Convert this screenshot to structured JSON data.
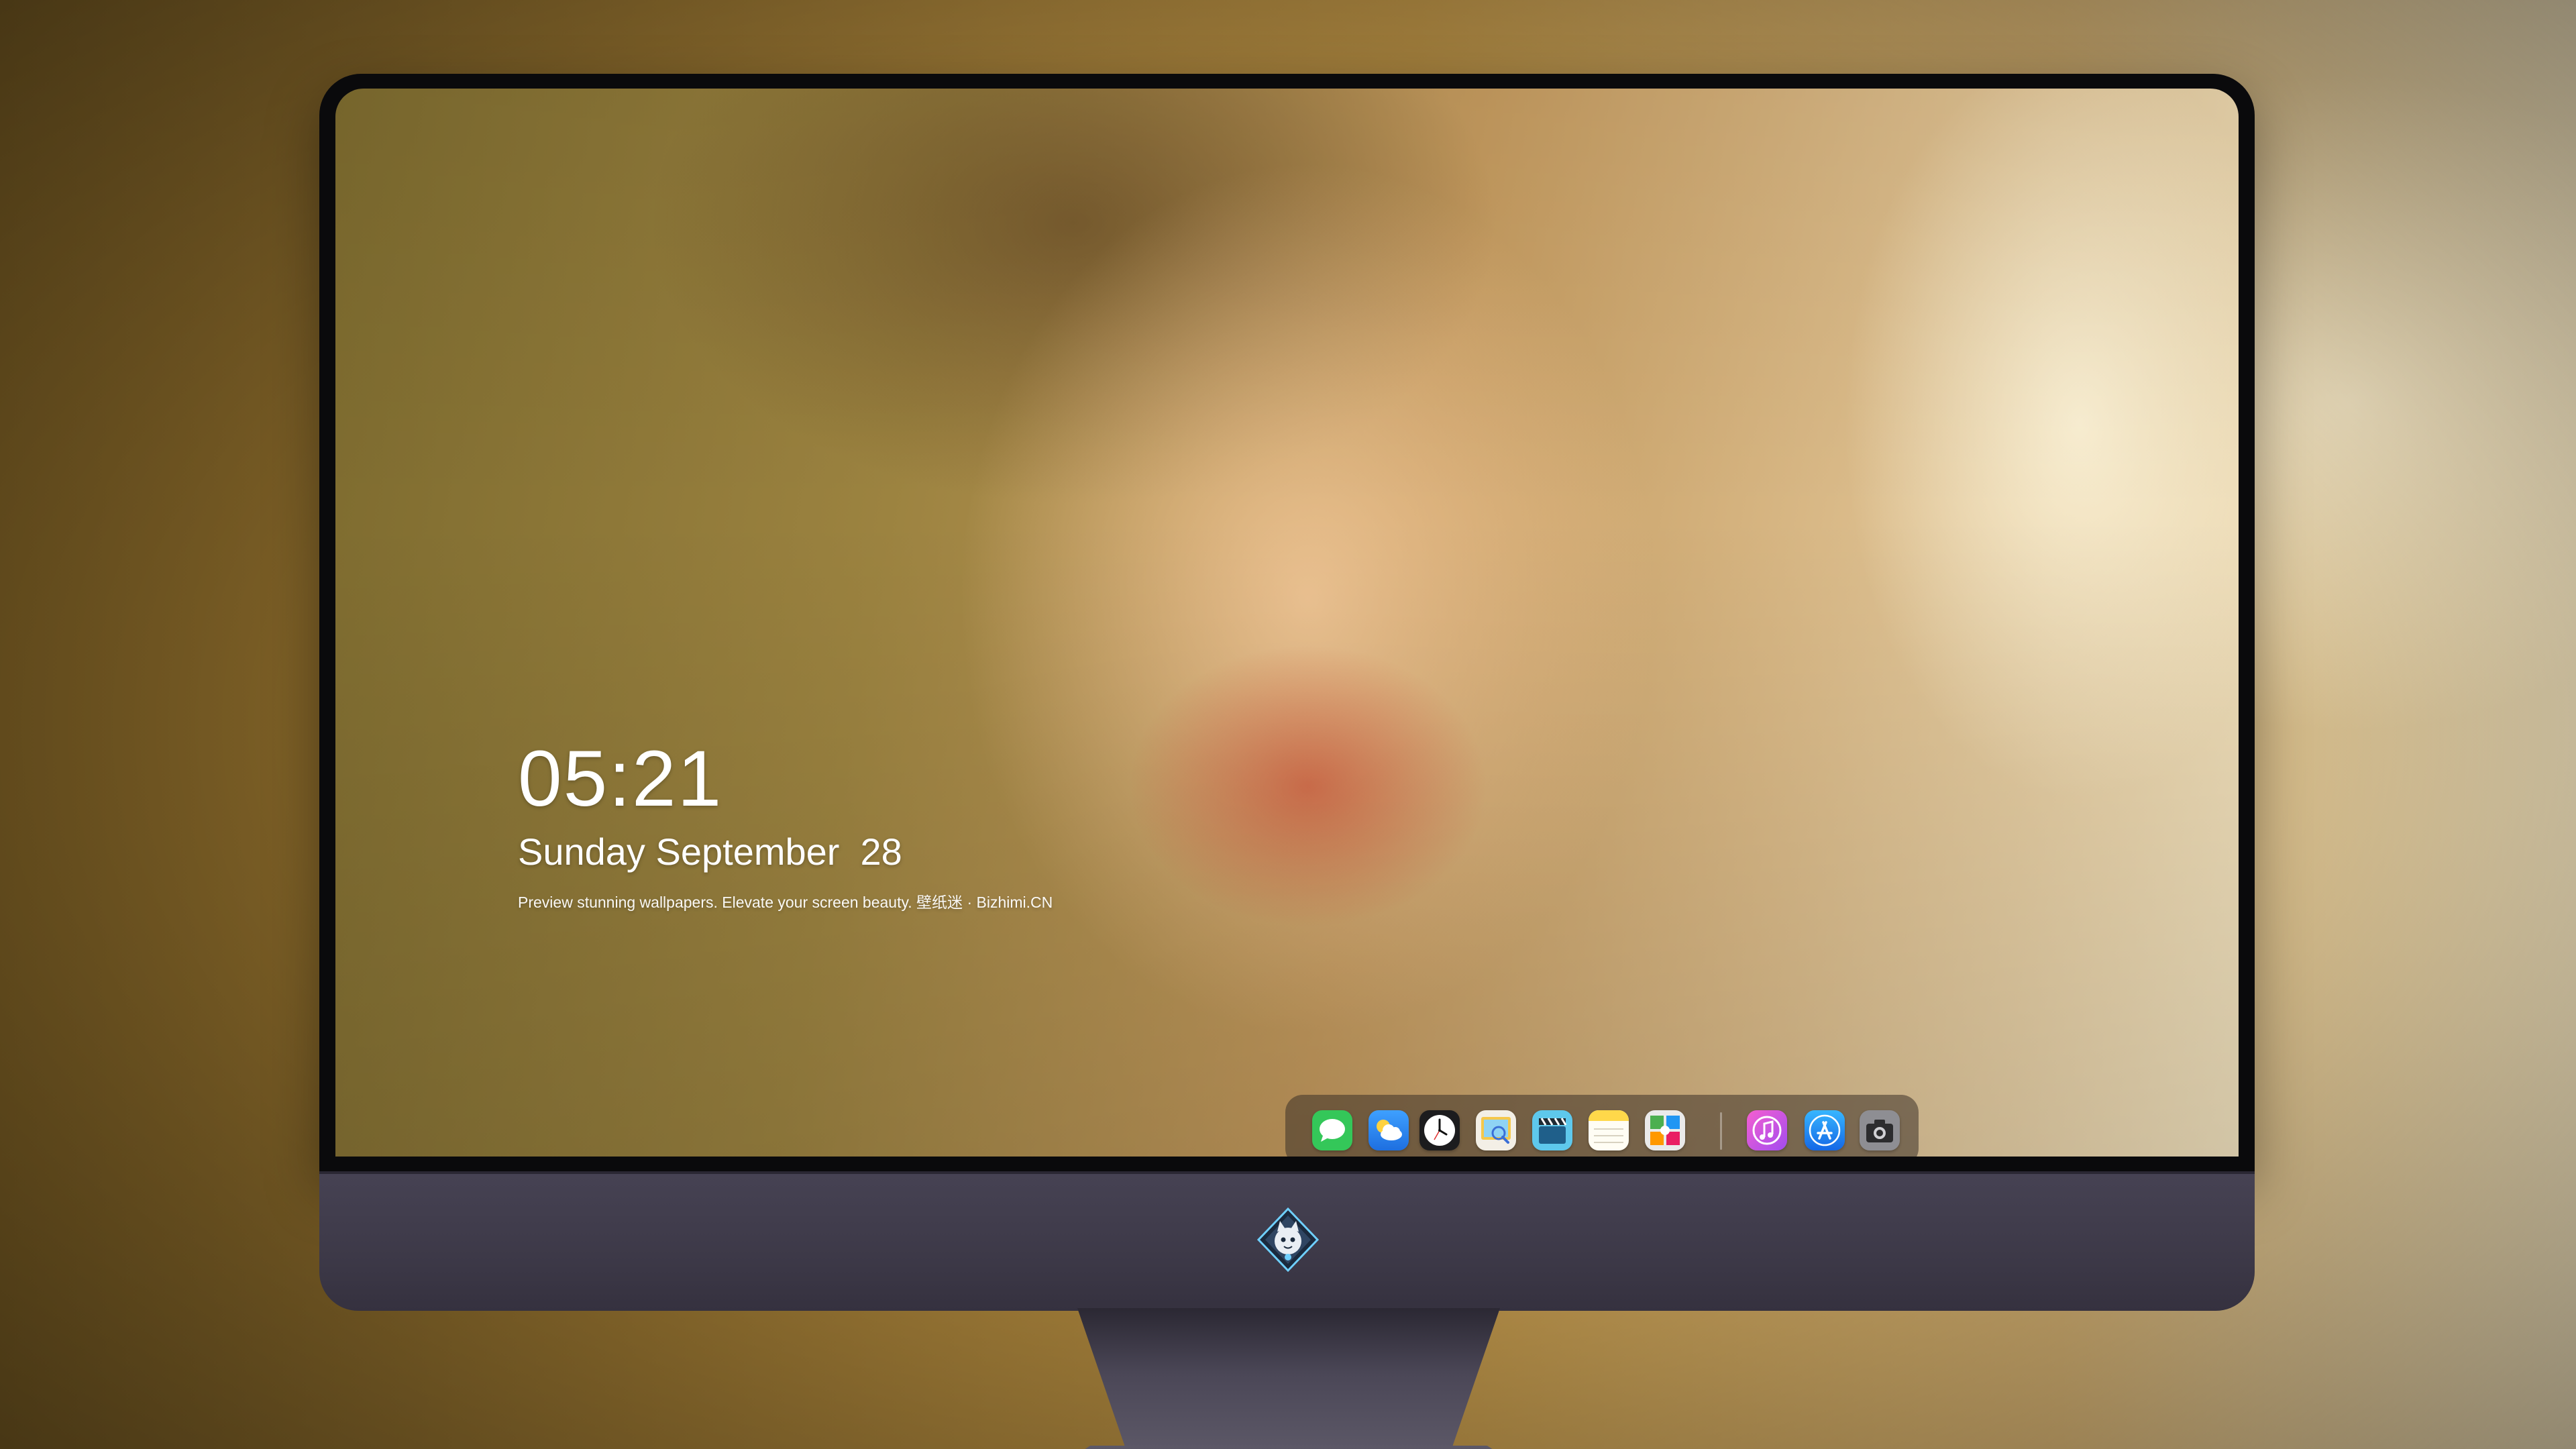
{
  "lock_screen": {
    "time": "05:21",
    "date": "Sunday September  28",
    "tagline": "Preview stunning wallpapers. Elevate your screen beauty. 壁纸迷 · Bizhimi.CN"
  },
  "dock": {
    "apps": [
      {
        "name": "Messages",
        "icon": "messages-icon",
        "color": "#34c759"
      },
      {
        "name": "Weather",
        "icon": "weather-icon",
        "color": "#2f8ff5"
      },
      {
        "name": "Clock",
        "icon": "clock-icon",
        "color": "#1c1c1e"
      },
      {
        "name": "Preview",
        "icon": "preview-icon",
        "color": "#f5c84b"
      },
      {
        "name": "Clips",
        "icon": "clapperboard-icon",
        "color": "#54c6e8"
      },
      {
        "name": "Notes",
        "icon": "notes-icon",
        "color": "#ffd84a"
      },
      {
        "name": "Photo Booth",
        "icon": "photo-booth-icon",
        "color": "#e8e8e8"
      },
      {
        "name": "iTunes",
        "icon": "music-icon",
        "color": "#e45ad6"
      },
      {
        "name": "App Store",
        "icon": "app-store-icon",
        "color": "#1e90ff"
      },
      {
        "name": "Camera",
        "icon": "camera-icon",
        "color": "#8e8e93"
      }
    ]
  },
  "brand": {
    "logo": "bizhimi-mascot-logo"
  }
}
